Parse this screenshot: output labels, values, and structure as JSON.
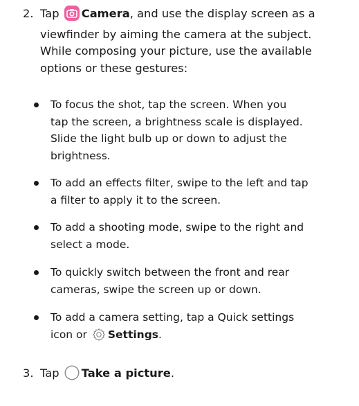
{
  "step2": {
    "number": "2.",
    "prefix": "Tap",
    "camera_label": "Camera",
    "suffix_line1": ", and use the display screen as a",
    "line2": "viewfinder by aiming the camera at the subject.",
    "line3": "While composing your picture, use the available",
    "line4": "options or these gestures:"
  },
  "bullets": [
    {
      "lines": [
        "To focus the shot, tap the screen. When you",
        "tap the screen, a brightness scale is displayed.",
        "Slide the light bulb up or down to adjust the",
        "brightness."
      ]
    },
    {
      "lines": [
        "To add an effects filter, swipe to the left and tap",
        "a filter to apply it to the screen."
      ]
    },
    {
      "lines": [
        "To add a shooting mode, swipe to the right and",
        "select a mode."
      ]
    },
    {
      "lines": [
        "To quickly switch between the front and rear",
        "cameras, swipe the screen up or down."
      ]
    },
    {
      "line1": "To add a camera setting, tap a Quick settings",
      "line2_prefix": "icon or",
      "settings_label": "Settings",
      "line2_suffix": "."
    }
  ],
  "step3": {
    "number": "3.",
    "prefix": "Tap",
    "take_label": "Take a picture",
    "suffix": "."
  },
  "icons": {
    "camera_icon": "camera-app-icon",
    "settings_icon": "gear-icon",
    "shutter_icon": "shutter-button-icon"
  },
  "colors": {
    "camera_icon_bg": "#ef5fa0",
    "text": "#1a1a1a",
    "icon_stroke": "#888888"
  }
}
